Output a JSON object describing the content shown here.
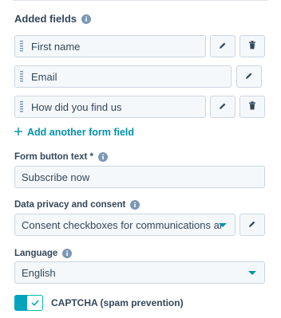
{
  "added_fields": {
    "title": "Added fields",
    "fields": [
      {
        "label": "First name",
        "deletable": true
      },
      {
        "label": "Email",
        "deletable": false
      },
      {
        "label": "How did you find us",
        "deletable": true
      }
    ],
    "add_link": "Add another form field"
  },
  "form_button": {
    "label": "Form button text *",
    "value": "Subscribe now"
  },
  "privacy": {
    "label": "Data privacy and consent",
    "value": "Consent checkboxes for communications and p..."
  },
  "language": {
    "label": "Language",
    "value": "English"
  },
  "captcha": {
    "label": "CAPTCHA (spam prevention)",
    "enabled": true
  },
  "colors": {
    "accent": "#0091ae",
    "toggle_on": "#00bda5",
    "text": "#33475b",
    "border": "#cbd6e2",
    "field_bg": "#f5f8fa"
  }
}
